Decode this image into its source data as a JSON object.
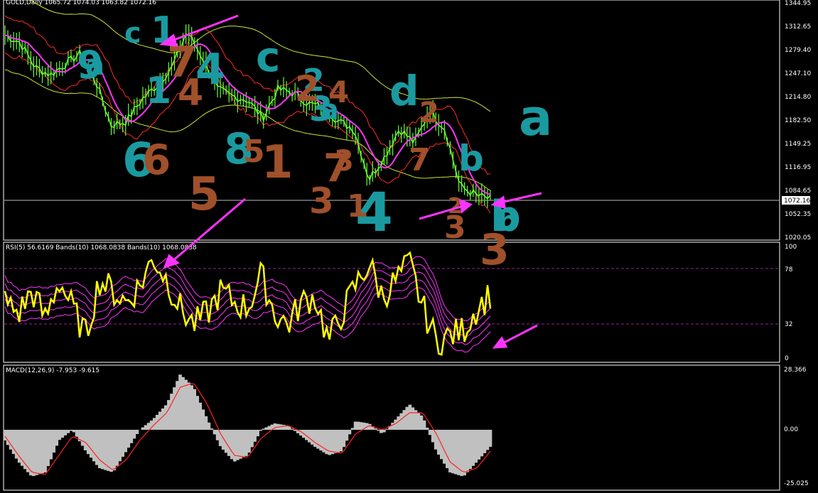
{
  "colors": {
    "background": "#000000",
    "frame": "#ffffff",
    "price": "#66ff33",
    "ma": "#ff33ff",
    "envelope": "#c8e632",
    "bollinger": "#ff2a2a",
    "rsi": "#ffff00",
    "rsi_bands": "#ff33ff",
    "macd_hist": "#c0c0c0",
    "macd_signal": "#ff2020",
    "current_price_line": "#c0c0c0",
    "current_price_box": "#ffffff",
    "arrow": "#ff33ff",
    "annot_teal": "#1a9aa0",
    "annot_brown": "#a0502a"
  },
  "price_panel": {
    "header": "GOLD,Daily  1065.72 1074.03 1063.82 1072.16",
    "current_price": "1072.16",
    "ticks": [
      "1344.95",
      "1312.65",
      "1279.40",
      "1247.10",
      "1214.80",
      "1182.50",
      "1149.25",
      "1116.95",
      "1084.65",
      "1052.35",
      "1020.05"
    ]
  },
  "rsi_panel": {
    "header": "RSI(5) 56.6169  Bands(10) 1068.0838  Bands(10) 1068.0838",
    "ticks": [
      "100",
      "78",
      "32",
      "0"
    ]
  },
  "macd_panel": {
    "header": "MACD(12,26,9) -7.953 -9.615",
    "ticks": [
      "28.366",
      "0.00",
      "-25.025"
    ]
  },
  "annotations": {
    "teal": [
      "6",
      "9",
      "1",
      "4",
      "c",
      "2",
      "8",
      "d",
      "3",
      "a",
      "b",
      "4",
      "1",
      "c",
      "a",
      "a",
      "b",
      "b"
    ],
    "brown": [
      "7",
      "4",
      "6",
      "2",
      "5",
      "1",
      "2",
      "4",
      "7",
      "3",
      "3",
      "1",
      "7",
      "3",
      "3",
      "2",
      "5"
    ]
  },
  "chart_data": [
    {
      "type": "line",
      "title": "GOLD,Daily",
      "ylim": [
        1020.05,
        1344.95
      ],
      "series": [
        {
          "name": "GOLD,Daily",
          "values": [
            1300,
            1290,
            1255,
            1245,
            1260,
            1275,
            1235,
            1175,
            1180,
            1210,
            1230,
            1255,
            1305,
            1270,
            1225,
            1215,
            1210,
            1185,
            1225,
            1220,
            1205,
            1200,
            1180,
            1170,
            1100,
            1130,
            1170,
            1150,
            1195,
            1170,
            1090,
            1078,
            1072
          ]
        }
      ]
    },
    {
      "type": "line",
      "title": "RSI(5)",
      "ylim": [
        0,
        100
      ],
      "series": [
        {
          "name": "RSI(5)",
          "values": [
            50,
            40,
            60,
            35,
            70,
            45,
            20,
            70,
            60,
            50,
            65,
            90,
            70,
            45,
            30,
            40,
            60,
            50,
            45,
            75,
            40,
            30,
            50,
            55,
            15,
            40,
            65,
            85,
            55,
            70,
            85,
            45,
            15,
            20,
            25,
            45,
            57
          ]
        }
      ]
    },
    {
      "type": "bar",
      "title": "MACD(12,26,9)",
      "ylim": [
        -25.025,
        28.366
      ],
      "series": [
        {
          "name": "MACD(12,26,9)",
          "values": [
            -5,
            -15,
            -22,
            -20,
            -5,
            0,
            -10,
            -18,
            -20,
            -10,
            0,
            5,
            12,
            26,
            20,
            5,
            -8,
            -15,
            -12,
            0,
            3,
            2,
            -3,
            -8,
            -12,
            -10,
            4,
            3,
            -2,
            5,
            12,
            6,
            -10,
            -20,
            -22,
            -15,
            -8
          ]
        },
        {
          "name": "Signal",
          "values": [
            -3,
            -12,
            -20,
            -21,
            -12,
            -3,
            -6,
            -14,
            -19,
            -14,
            -5,
            2,
            8,
            20,
            22,
            12,
            -2,
            -12,
            -13,
            -4,
            1,
            2,
            -1,
            -6,
            -10,
            -11,
            -2,
            2,
            0,
            3,
            8,
            8,
            -2,
            -15,
            -20,
            -18,
            -10
          ]
        }
      ]
    }
  ]
}
